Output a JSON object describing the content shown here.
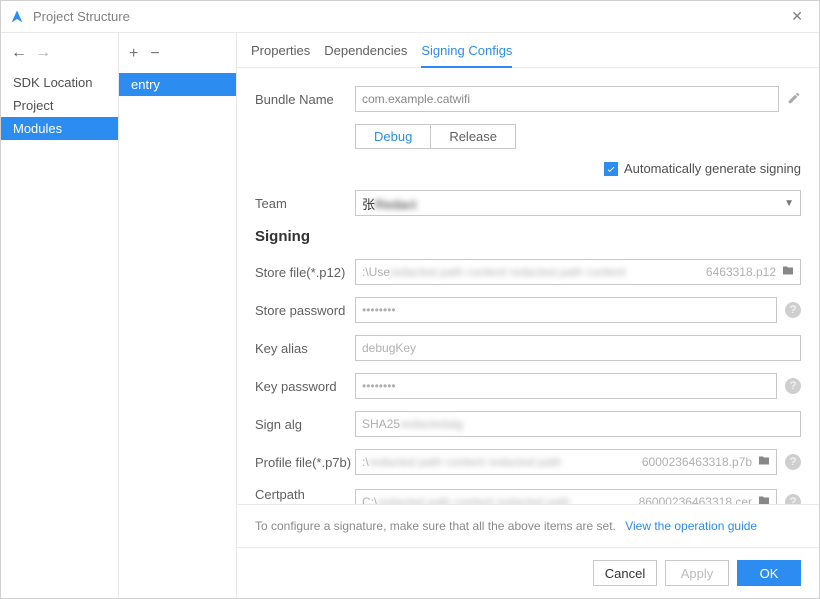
{
  "window": {
    "title": "Project Structure"
  },
  "sidebar": {
    "items": [
      "SDK Location",
      "Project",
      "Modules"
    ],
    "selected": 2
  },
  "modules": {
    "items": [
      "entry"
    ],
    "selected": 0
  },
  "tabs": {
    "items": [
      "Properties",
      "Dependencies",
      "Signing Configs"
    ],
    "selected": 2
  },
  "bundle": {
    "label": "Bundle Name",
    "value": "com.example.catwifi"
  },
  "build_types": {
    "options": [
      "Debug",
      "Release"
    ],
    "selected": 0
  },
  "auto_sign": {
    "label": "Automatically generate signing",
    "checked": true
  },
  "team": {
    "label": "Team",
    "value": "张"
  },
  "signing_heading": "Signing",
  "fields": {
    "store_file": {
      "label": "Store file(*.p12)",
      "value": ":\\Use",
      "suffix": "6463318.p12",
      "browse": true,
      "help": false
    },
    "store_pw": {
      "label": "Store password",
      "value": "••••••••",
      "help": true
    },
    "key_alias": {
      "label": "Key alias",
      "value": "debugKey",
      "help": false
    },
    "key_pw": {
      "label": "Key password",
      "value": "••••••••",
      "help": true
    },
    "sign_alg": {
      "label": "Sign alg",
      "value": "SHA25",
      "help": false
    },
    "profile": {
      "label": "Profile file(*.p7b)",
      "value": ":\\",
      "suffix": "6000236463318.p7b",
      "browse": true,
      "help": true
    },
    "certpath": {
      "label": "Certpath file(*.cer)",
      "value": "C:\\",
      "suffix": "86000236463318.cer",
      "browse": true,
      "help": true
    }
  },
  "footer": {
    "note": "To configure a signature, make sure that all the above items are set.",
    "link": "View the operation guide"
  },
  "buttons": {
    "cancel": "Cancel",
    "apply": "Apply",
    "ok": "OK"
  }
}
